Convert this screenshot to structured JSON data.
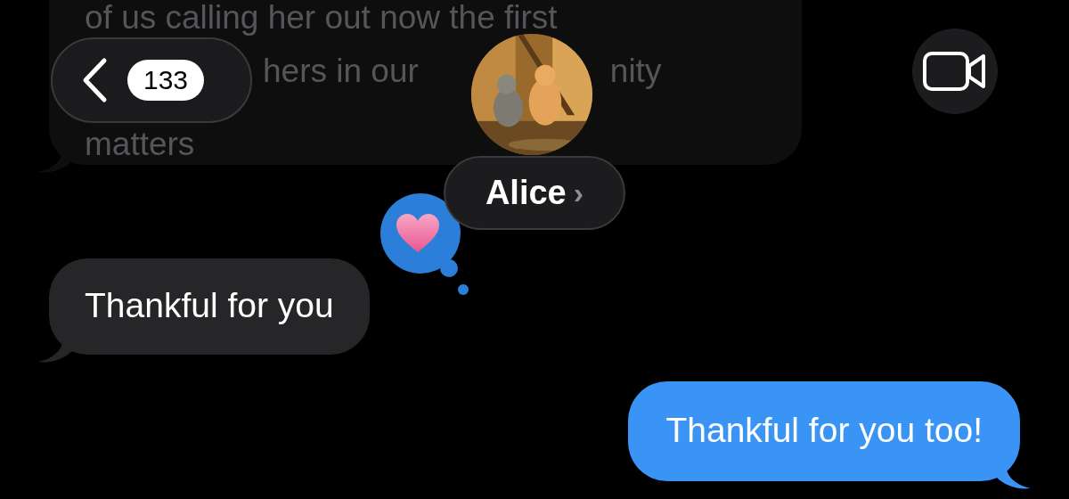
{
  "conversation": {
    "back_count": "133",
    "contact_name": "Alice",
    "contact_chevron": "›"
  },
  "messages": [
    {
      "kind": "faded",
      "lines": [
        [
          "of us calling her out now the first"
        ],
        [
          "hers in our",
          "nity"
        ],
        [
          "matters"
        ]
      ]
    },
    {
      "kind": "received",
      "text": "Thankful for you",
      "tapback": {
        "kind": "heart"
      }
    },
    {
      "kind": "sent",
      "text": "Thankful for you too!"
    }
  ]
}
